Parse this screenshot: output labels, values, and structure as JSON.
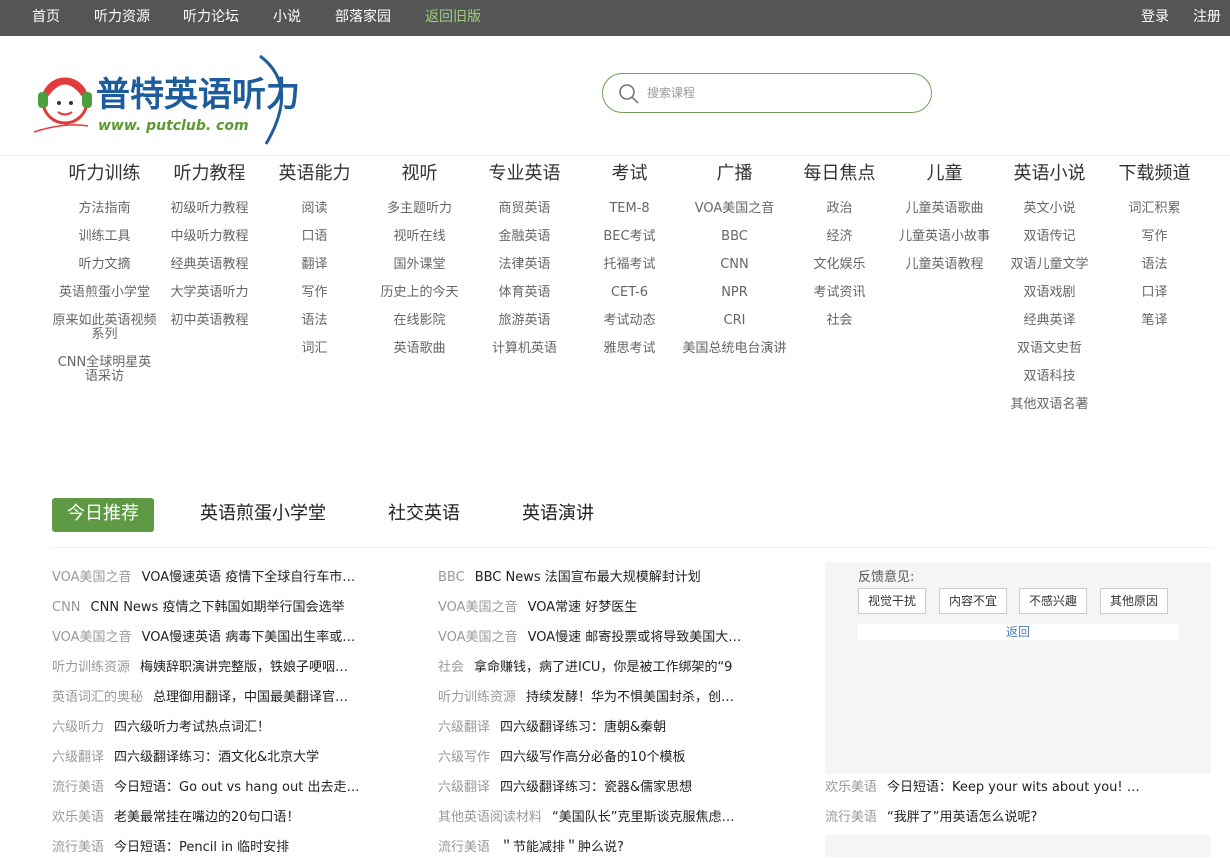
{
  "topnav": {
    "left": [
      "首页",
      "听力资源",
      "听力论坛",
      "小说",
      "部落家园",
      "返回旧版"
    ],
    "right": [
      "登录",
      "注册"
    ]
  },
  "logo": {
    "cn": "普特英语听力",
    "url": "www. putclub. com"
  },
  "search": {
    "placeholder": "搜索课程"
  },
  "nav": [
    {
      "title": "听力训练",
      "items": [
        "方法指南",
        "训练工具",
        "听力文摘",
        "英语煎蛋小学堂",
        "原来如此英语视频系列",
        "CNN全球明星英语采访"
      ]
    },
    {
      "title": "听力教程",
      "items": [
        "初级听力教程",
        "中级听力教程",
        "经典英语教程",
        "大学英语听力",
        "初中英语教程"
      ]
    },
    {
      "title": "英语能力",
      "items": [
        "阅读",
        "口语",
        "翻译",
        "写作",
        "语法",
        "词汇"
      ]
    },
    {
      "title": "视听",
      "items": [
        "多主题听力",
        "视听在线",
        "国外课堂",
        "历史上的今天",
        "在线影院",
        "英语歌曲"
      ]
    },
    {
      "title": "专业英语",
      "items": [
        "商贸英语",
        "金融英语",
        "法律英语",
        "体育英语",
        "旅游英语",
        "计算机英语"
      ]
    },
    {
      "title": "考试",
      "items": [
        "TEM-8",
        "BEC考试",
        "托福考试",
        "CET-6",
        "考试动态",
        "雅思考试"
      ]
    },
    {
      "title": "广播",
      "items": [
        "VOA美国之音",
        "BBC",
        "CNN",
        "NPR",
        "CRI",
        "美国总统电台演讲"
      ]
    },
    {
      "title": "每日焦点",
      "items": [
        "政治",
        "经济",
        "文化娱乐",
        "考试资讯",
        "社会"
      ]
    },
    {
      "title": "儿童",
      "items": [
        "儿童英语歌曲",
        "儿童英语小故事",
        "儿童英语教程"
      ]
    },
    {
      "title": "英语小说",
      "items": [
        "英文小说",
        "双语传记",
        "双语儿童文学",
        "双语戏剧",
        "经典英译",
        "双语文史哲",
        "双语科技",
        "其他双语名著"
      ]
    },
    {
      "title": "下载频道",
      "items": [
        "词汇积累",
        "写作",
        "语法",
        "口译",
        "笔译"
      ]
    }
  ],
  "tabs": [
    "今日推荐",
    "英语煎蛋小学堂",
    "社交英语",
    "英语演讲"
  ],
  "col1": [
    {
      "cat": "VOA美国之音",
      "title": "VOA慢速英语 疫情下全球自行车市…"
    },
    {
      "cat": "CNN",
      "title": "CNN News 疫情之下韩国如期举行国会选举"
    },
    {
      "cat": "VOA美国之音",
      "title": "VOA慢速英语 病毒下美国出生率或…"
    },
    {
      "cat": "听力训练资源",
      "title": "梅姨辞职演讲完整版，铁娘子哽咽…"
    },
    {
      "cat": "英语词汇的奥秘",
      "title": "总理御用翻译，中国最美翻译官…"
    },
    {
      "cat": "六级听力",
      "title": "四六级听力考试热点词汇！"
    },
    {
      "cat": "六级翻译",
      "title": "四六级翻译练习：酒文化&北京大学"
    },
    {
      "cat": "流行美语",
      "title": "今日短语：Go out vs hang out 出去走…"
    },
    {
      "cat": "欢乐美语",
      "title": "老美最常挂在嘴边的20句口语！"
    },
    {
      "cat": "流行美语",
      "title": "今日短语：Pencil in 临时安排"
    }
  ],
  "col2": [
    {
      "cat": "BBC",
      "title": "BBC News 法国宣布最大规模解封计划"
    },
    {
      "cat": "VOA美国之音",
      "title": "VOA常速 好梦医生"
    },
    {
      "cat": "VOA美国之音",
      "title": "VOA慢速 邮寄投票或将导致美国大…"
    },
    {
      "cat": "社会",
      "title": "拿命赚钱，病了进ICU，你是被工作绑架的“9"
    },
    {
      "cat": "听力训练资源",
      "title": "持续发酵！华为不惧美国封杀，创…"
    },
    {
      "cat": "六级翻译",
      "title": "四六级翻译练习：唐朝&秦朝"
    },
    {
      "cat": "六级写作",
      "title": "四六级写作高分必备的10个模板"
    },
    {
      "cat": "六级翻译",
      "title": "四六级翻译练习：瓷器&儒家思想"
    },
    {
      "cat": "其他英语阅读材料",
      "title": "“美国队长”克里斯谈克服焦虑…"
    },
    {
      "cat": "流行美语",
      "title": "＂节能减排＂肿么说?"
    }
  ],
  "col3": [
    {
      "cat": "欢乐美语",
      "title": "今日短语：Keep your wits about you! …"
    },
    {
      "cat": "流行美语",
      "title": "“我胖了”用英语怎么说呢?"
    }
  ],
  "feedback": {
    "label": "反馈意见:",
    "options": [
      "视觉干扰",
      "内容不宜",
      "不感兴趣",
      "其他原因"
    ],
    "back": "返回"
  }
}
